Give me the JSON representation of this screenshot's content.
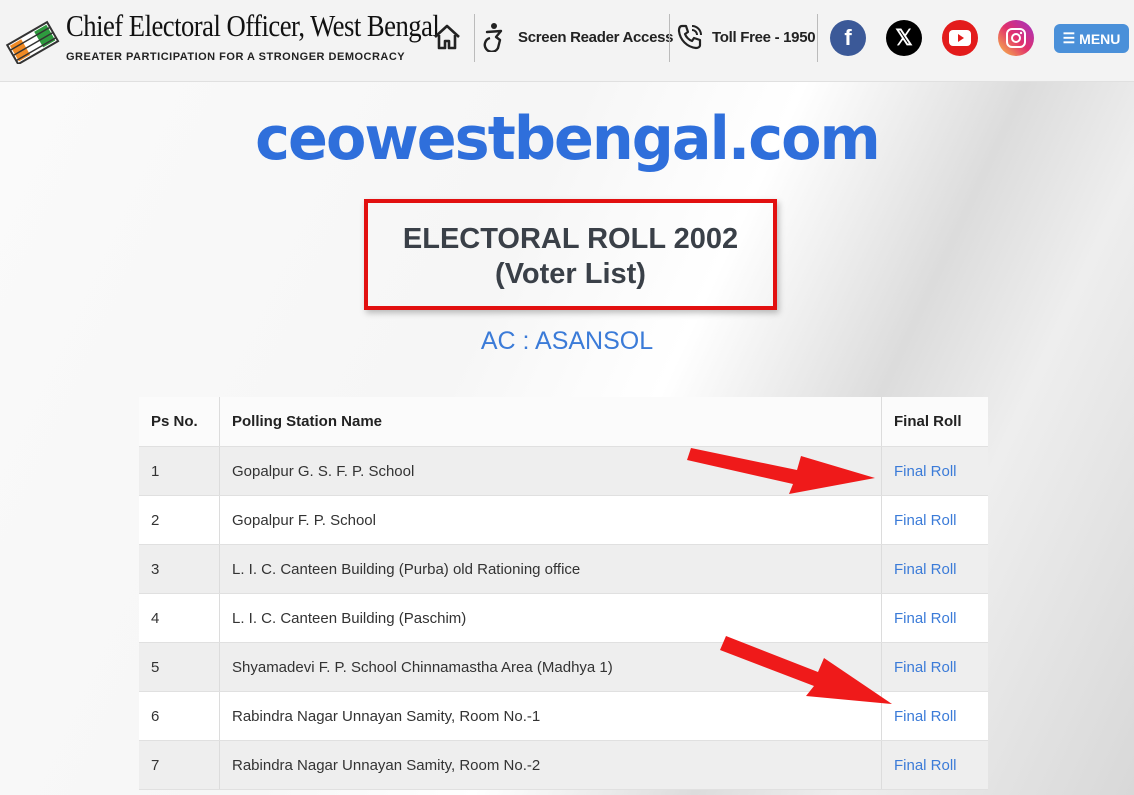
{
  "header": {
    "logo_title": "Chief Electoral Officer, West Bengal",
    "logo_tagline": "GREATER PARTICIPATION FOR A STRONGER DEMOCRACY",
    "home_icon": "home-icon",
    "screen_reader_label": "Screen Reader Access",
    "toll_free_label": "Toll Free - 1950",
    "social": [
      "facebook",
      "x",
      "youtube",
      "instagram"
    ],
    "menu_label": "MENU"
  },
  "main": {
    "domain": "ceowestbengal.com",
    "roll_title": "ELECTORAL ROLL 2002",
    "roll_subtitle": "(Voter List)",
    "ac_label": "AC : ASANSOL"
  },
  "table": {
    "columns": [
      "Ps No.",
      "Polling Station Name",
      "Final Roll"
    ],
    "rows": [
      {
        "ps": "1",
        "name": "Gopalpur G. S. F. P. School",
        "link": "Final Roll"
      },
      {
        "ps": "2",
        "name": "Gopalpur F. P. School",
        "link": "Final Roll"
      },
      {
        "ps": "3",
        "name": "L. I. C. Canteen Building (Purba) old Rationing office",
        "link": "Final Roll"
      },
      {
        "ps": "4",
        "name": "L. I. C. Canteen Building (Paschim)",
        "link": "Final Roll"
      },
      {
        "ps": "5",
        "name": "Shyamadevi F. P. School Chinnamastha Area (Madhya 1)",
        "link": "Final Roll"
      },
      {
        "ps": "6",
        "name": "Rabindra Nagar Unnayan Samity, Room No.-1",
        "link": "Final Roll"
      },
      {
        "ps": "7",
        "name": "Rabindra Nagar Unnayan Samity, Room No.-2",
        "link": "Final Roll"
      }
    ]
  },
  "colors": {
    "accent_blue": "#2f6fdb",
    "link_blue": "#3b7bd8",
    "highlight_red": "#e21010",
    "menu_blue": "#4a90d9"
  }
}
